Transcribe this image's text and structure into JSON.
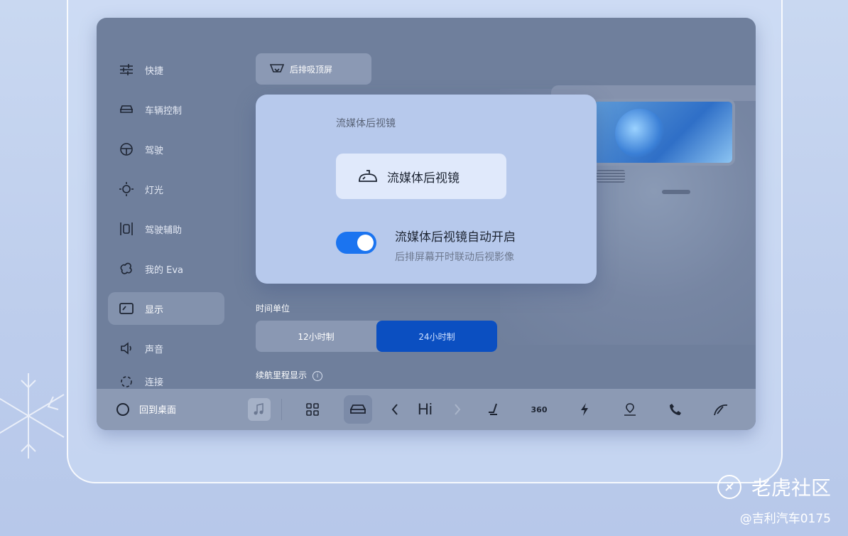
{
  "sidebar": {
    "items": [
      {
        "label": "快捷",
        "icon": "sliders-icon"
      },
      {
        "label": "车辆控制",
        "icon": "car-icon"
      },
      {
        "label": "驾驶",
        "icon": "steering-wheel-icon"
      },
      {
        "label": "灯光",
        "icon": "sun-icon"
      },
      {
        "label": "驾驶辅助",
        "icon": "assist-icon"
      },
      {
        "label": "我的 Eva",
        "icon": "eva-icon"
      },
      {
        "label": "显示",
        "icon": "display-icon",
        "active": true
      },
      {
        "label": "声音",
        "icon": "speaker-icon"
      },
      {
        "label": "连接",
        "icon": "link-icon"
      }
    ]
  },
  "main": {
    "top_button": "后排吸顶屏",
    "time_unit_label": "时间单位",
    "time_options": [
      "12小时制",
      "24小时制"
    ],
    "time_selected": "24小时制",
    "range_label": "续航里程显示"
  },
  "modal": {
    "title": "流媒体后视镜",
    "button_label": "流媒体后视镜",
    "option_title": "流媒体后视镜自动开启",
    "option_subtitle": "后排屏幕开时联动后视影像",
    "toggle_on": true
  },
  "bottom_bar": {
    "home_label": "回到桌面",
    "hi_label": "Hi",
    "icons": [
      "music-icon",
      "apps-grid-icon",
      "car-icon",
      "chevron-left-icon",
      "chevron-right-icon",
      "seat-icon",
      "camera-360-icon",
      "bolt-icon",
      "location-icon",
      "phone-icon",
      "wiper-icon"
    ],
    "camera_360_label": "360"
  },
  "watermark": {
    "brand": "老虎社区",
    "handle": "@吉利汽车0175"
  },
  "colors": {
    "accent": "#1b74f0",
    "selected_segment": "#0b4fc1",
    "screen_bg": "#6f7f9c"
  }
}
